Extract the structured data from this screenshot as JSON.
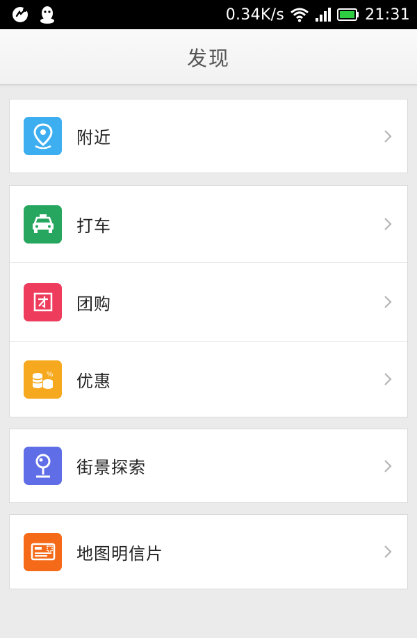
{
  "status_bar": {
    "net_speed": "0.34K/s",
    "time": "21:31",
    "icons": [
      "sync-call-icon",
      "qq-penguin-icon",
      "wifi-icon",
      "cell-signal-icon",
      "battery-icon"
    ],
    "battery_color": "#2ecc40"
  },
  "header": {
    "title": "发现"
  },
  "menu": {
    "nearby": {
      "label": "附近",
      "icon": "location-pin-icon",
      "color": "#3daef0"
    },
    "taxi": {
      "label": "打车",
      "icon": "taxi-icon",
      "color": "#27a65f"
    },
    "groupbuy": {
      "label": "团购",
      "icon": "groupbuy-icon",
      "color": "#ee3d5c"
    },
    "deals": {
      "label": "优惠",
      "icon": "coins-icon",
      "color": "#f6a81e"
    },
    "street": {
      "label": "街景探索",
      "icon": "street-view-icon",
      "color": "#5f6ee6"
    },
    "postcard": {
      "label": "地图明信片",
      "icon": "postcard-icon",
      "color": "#f56a18"
    }
  }
}
